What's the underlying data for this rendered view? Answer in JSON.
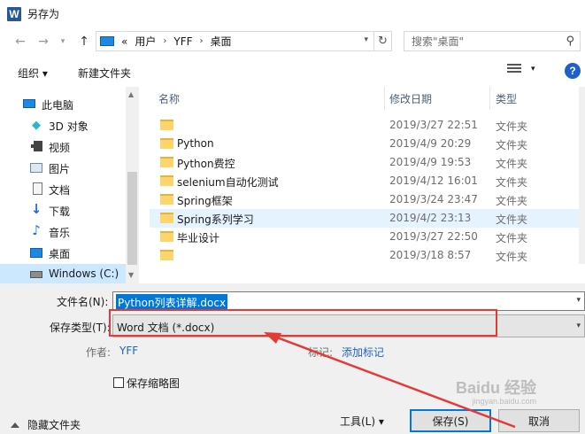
{
  "window": {
    "title": "另存为",
    "app_icon_letter": "W"
  },
  "address": {
    "overflow": "«",
    "segments": [
      "用户",
      "YFF",
      "桌面"
    ],
    "search_placeholder": "搜索\"桌面\""
  },
  "toolbar": {
    "organize": "组织 ▾",
    "new_folder": "新建文件夹"
  },
  "nav": {
    "items": [
      {
        "label": "此电脑",
        "icon": "pc-icon"
      },
      {
        "label": "3D 对象",
        "icon": "cube-icon"
      },
      {
        "label": "视频",
        "icon": "video-icon"
      },
      {
        "label": "图片",
        "icon": "pictures-icon"
      },
      {
        "label": "文档",
        "icon": "documents-icon"
      },
      {
        "label": "下载",
        "icon": "download-icon"
      },
      {
        "label": "音乐",
        "icon": "music-icon"
      },
      {
        "label": "桌面",
        "icon": "desktop-icon"
      },
      {
        "label": "Windows  (C:)",
        "icon": "drive-icon"
      }
    ]
  },
  "files": {
    "columns": {
      "name": "名称",
      "date": "修改日期",
      "type": "类型"
    },
    "rows": [
      {
        "name": "",
        "date": "2019/3/27 22:51",
        "type": "文件夹"
      },
      {
        "name": "Python",
        "date": "2019/4/9 20:29",
        "type": "文件夹"
      },
      {
        "name": "Python费控",
        "date": "2019/4/9 19:53",
        "type": "文件夹"
      },
      {
        "name": "selenium自动化测试",
        "date": "2019/4/12 16:01",
        "type": "文件夹"
      },
      {
        "name": "Spring框架",
        "date": "2019/3/24 23:47",
        "type": "文件夹"
      },
      {
        "name": "Spring系列学习",
        "date": "2019/4/2 23:13",
        "type": "文件夹"
      },
      {
        "name": "毕业设计",
        "date": "2019/3/27 22:50",
        "type": "文件夹"
      },
      {
        "name": "",
        "date": "2019/3/18 8:57",
        "type": "文件夹"
      }
    ]
  },
  "form": {
    "filename_label": "文件名(N):",
    "filename_value": "Python列表详解.docx",
    "savetype_label": "保存类型(T):",
    "savetype_value": "Word 文档 (*.docx)",
    "author_label": "作者:",
    "author_value": "YFF",
    "tags_label": "标记:",
    "tags_value": "添加标记",
    "thumbnail_label": "保存缩略图",
    "hide_folders": "隐藏文件夹",
    "tools": "工具(L)  ▾",
    "save": "保存(S)",
    "cancel": "取消"
  },
  "watermark": {
    "text": "Baidu 经验",
    "sub": "jingyan.baidu.com"
  },
  "colors": {
    "accent": "#0078d7",
    "highlight": "#e53935",
    "selected_nav": "#cce8ff"
  }
}
